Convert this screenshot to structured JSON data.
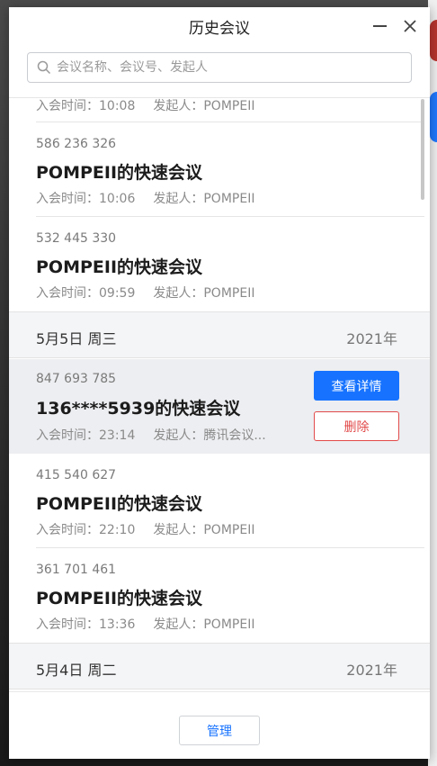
{
  "window": {
    "title": "历史会议"
  },
  "search": {
    "placeholder": "会议名称、会议号、发起人"
  },
  "items": [
    {
      "number": "",
      "name": "",
      "join_label": "入会时间：10:08",
      "host_label": "发起人：POMPEII"
    },
    {
      "number": "586 236 326",
      "name": "POMPEII的快速会议",
      "join_label": "入会时间：10:06",
      "host_label": "发起人：POMPEII"
    },
    {
      "number": "532 445 330",
      "name": "POMPEII的快速会议",
      "join_label": "入会时间：09:59",
      "host_label": "发起人：POMPEII"
    },
    {
      "number": "847 693 785",
      "name": "136****5939的快速会议",
      "join_label": "入会时间：23:14",
      "host_label": "发起人：腾讯会议...",
      "detail_label": "查看详情",
      "delete_label": "删除"
    },
    {
      "number": "415 540 627",
      "name": "POMPEII的快速会议",
      "join_label": "入会时间：22:10",
      "host_label": "发起人：POMPEII"
    },
    {
      "number": "361 701 461",
      "name": "POMPEII的快速会议",
      "join_label": "入会时间：13:36",
      "host_label": "发起人：POMPEII"
    }
  ],
  "date_groups": [
    {
      "date": "5月5日 周三",
      "year": "2021年"
    },
    {
      "date": "5月4日 周二",
      "year": "2021年"
    }
  ],
  "footer": {
    "manage_label": "管理"
  },
  "colors": {
    "accent": "#1773ff",
    "danger": "#e24a4a",
    "selected_bg": "#edeef1"
  }
}
